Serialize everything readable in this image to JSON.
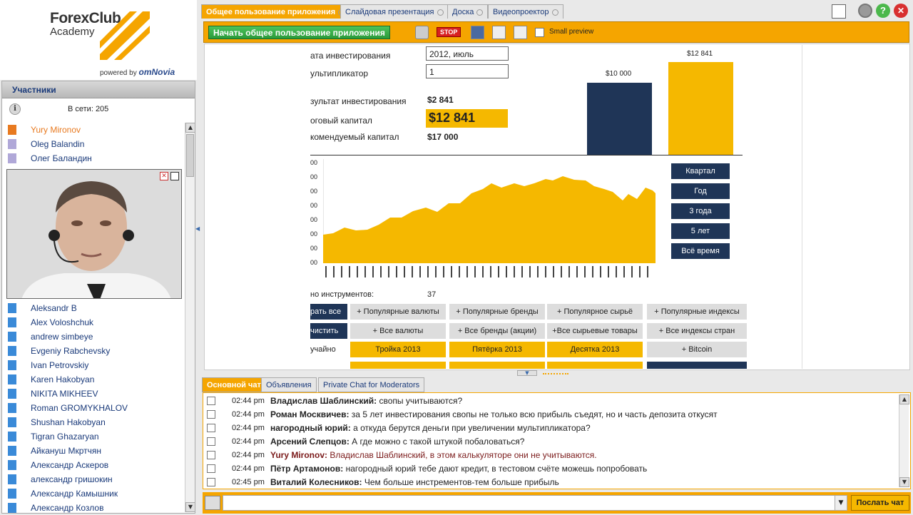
{
  "logo": {
    "line1": "ForexClub",
    "line2": "Academy",
    "powered_prefix": "powered by",
    "powered_brand": "omNovia"
  },
  "participants": {
    "title": "Участники",
    "online_label": "В сети:  205",
    "top": [
      {
        "name": "Yury Mironov",
        "role": "presenter"
      },
      {
        "name": "Oleg Balandin",
        "role": "moderator"
      },
      {
        "name": "Олег Баландин",
        "role": "moderator"
      }
    ],
    "list": [
      "Aleksandr B",
      "Alex Voloshchuk",
      "andrew simbeye",
      "Evgeniy Rabchevsky",
      "Ivan Petrovskiy",
      "Karen Hakobyan",
      "NIKITA MIKHEEV",
      "Roman GROMYKHALOV",
      "Shushan Hakobyan",
      "Tigran Ghazaryan",
      "Айкануш Мкртчян",
      "Александр Аскеров",
      "александр гришокин",
      "Александр Камышник",
      "Александр Козлов"
    ]
  },
  "tabs": [
    "Общее пользование приложения",
    "Слайдовая презентация",
    "Доска",
    "Видеопроектор"
  ],
  "toolbar": {
    "start_share": "Начать общее пользование приложения",
    "stop": "STOP",
    "small_preview": "Small preview"
  },
  "sheet": {
    "rows": [
      {
        "label": "ата инвестирования",
        "value": "2012, июль"
      },
      {
        "label": "ультипликатор",
        "value": "1"
      }
    ],
    "result_label": "зультат инвестирования",
    "result_value": "$2 841",
    "capital_label": "оговый капитал",
    "capital_value": "$12 841",
    "rec_label": "комендуемый капитал",
    "rec_value": "$17 000",
    "bar_labels": [
      "$10 000",
      "$12 841"
    ],
    "periods": [
      "Квартал",
      "Год",
      "3 года",
      "5 лет",
      "Всё время"
    ],
    "instruments_label": "но инструментов:",
    "instruments_value": "37",
    "y_ticks": [
      "00",
      "00",
      "00",
      "00",
      "00",
      "00",
      "00",
      "00"
    ],
    "btn_row1": [
      "рать все",
      "+ Популярные валюты",
      "+ Популярные бренды",
      "+ Популярное сырьё",
      "+ Популярные индексы"
    ],
    "btn_row2": [
      "чистить",
      "+ Все валюты",
      "+ Все бренды (акции)",
      "+Все сырьевые товары",
      "+ Все  индексы стран"
    ],
    "btn_row3": [
      "учайно",
      "Тройка 2013",
      "Пятёрка 2013",
      "Десятка 2013",
      "+ Bitcoin"
    ]
  },
  "chat": {
    "tabs": [
      "Основной чат",
      "Объявления",
      "Private Chat for Moderators"
    ],
    "messages": [
      {
        "time": "02:44 pm",
        "author": "Владислав Шаблинский:",
        "text": " свопы учитываются?",
        "mod": false
      },
      {
        "time": "02:44 pm",
        "author": "Роман Москвичев:",
        "text": " за 5 лет инвестирования свопы не только всю прибыль съедят, но и часть депозита откусят",
        "mod": false
      },
      {
        "time": "02:44 pm",
        "author": "нагородный юрий:",
        "text": " а откуда берутся деньги при увеличении мультипликатора?",
        "mod": false
      },
      {
        "time": "02:44 pm",
        "author": "Арсений Слепцов:",
        "text": " А где можно с такой штукой побаловаться?",
        "mod": false
      },
      {
        "time": "02:44 pm",
        "author": "Yury Mironov:",
        "text": " Владислав Шаблинский, в этом калькуляторе они не учитываются.",
        "mod": true
      },
      {
        "time": "02:44 pm",
        "author": "Пётр Артамонов:",
        "text": " нагородный юрий тебе дают кредит, в тестовом счёте можешь попробовать",
        "mod": false
      },
      {
        "time": "02:45 pm",
        "author": "Виталий Колесников:",
        "text": " Чем больше инстрементов-тем больше прибыль",
        "mod": false
      }
    ],
    "send": "Послать чат"
  },
  "colors": {
    "accent": "#f5a500",
    "navy": "#1f3557",
    "gold": "#f5b800"
  }
}
